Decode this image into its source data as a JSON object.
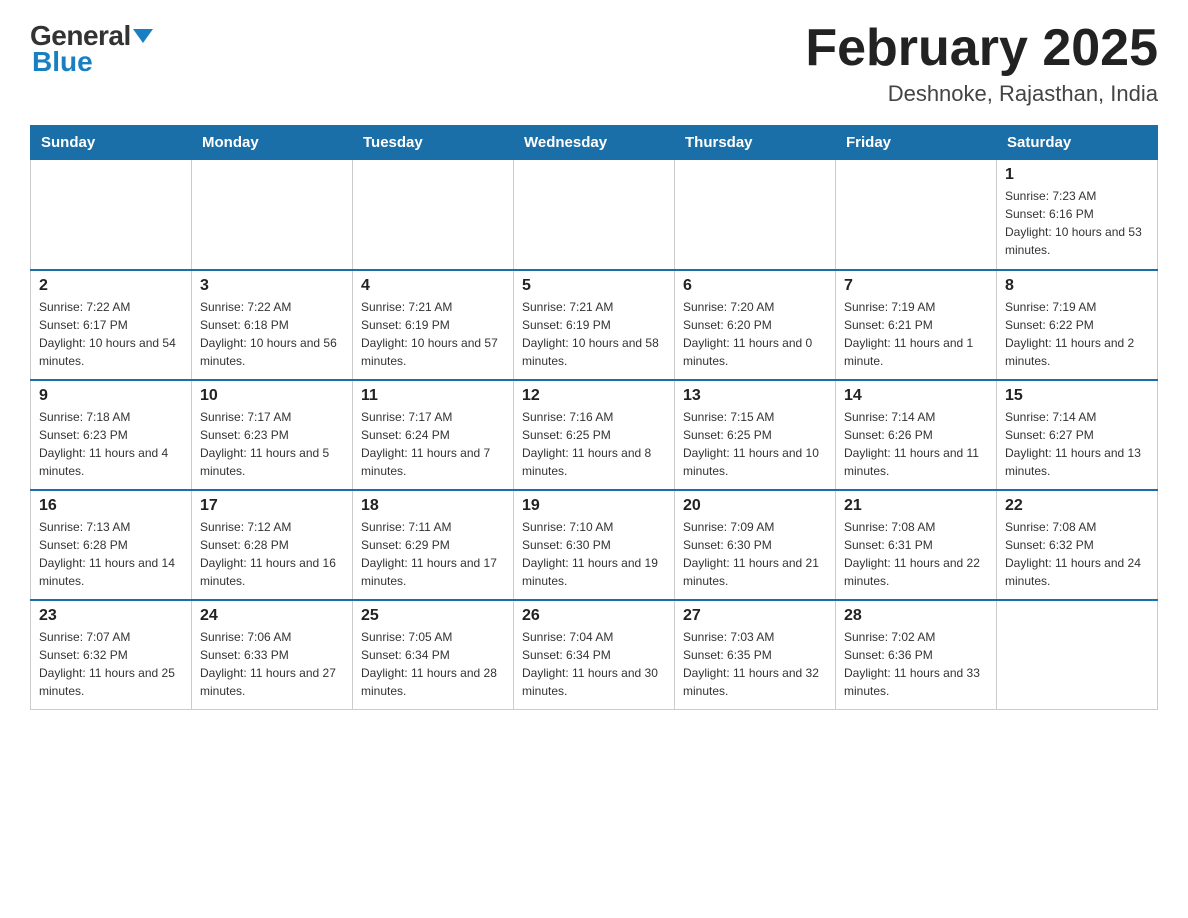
{
  "header": {
    "logo_general": "General",
    "logo_blue": "Blue",
    "title": "February 2025",
    "subtitle": "Deshnoke, Rajasthan, India"
  },
  "days_of_week": [
    "Sunday",
    "Monday",
    "Tuesday",
    "Wednesday",
    "Thursday",
    "Friday",
    "Saturday"
  ],
  "weeks": [
    [
      {
        "day": "",
        "sunrise": "",
        "sunset": "",
        "daylight": ""
      },
      {
        "day": "",
        "sunrise": "",
        "sunset": "",
        "daylight": ""
      },
      {
        "day": "",
        "sunrise": "",
        "sunset": "",
        "daylight": ""
      },
      {
        "day": "",
        "sunrise": "",
        "sunset": "",
        "daylight": ""
      },
      {
        "day": "",
        "sunrise": "",
        "sunset": "",
        "daylight": ""
      },
      {
        "day": "",
        "sunrise": "",
        "sunset": "",
        "daylight": ""
      },
      {
        "day": "1",
        "sunrise": "Sunrise: 7:23 AM",
        "sunset": "Sunset: 6:16 PM",
        "daylight": "Daylight: 10 hours and 53 minutes."
      }
    ],
    [
      {
        "day": "2",
        "sunrise": "Sunrise: 7:22 AM",
        "sunset": "Sunset: 6:17 PM",
        "daylight": "Daylight: 10 hours and 54 minutes."
      },
      {
        "day": "3",
        "sunrise": "Sunrise: 7:22 AM",
        "sunset": "Sunset: 6:18 PM",
        "daylight": "Daylight: 10 hours and 56 minutes."
      },
      {
        "day": "4",
        "sunrise": "Sunrise: 7:21 AM",
        "sunset": "Sunset: 6:19 PM",
        "daylight": "Daylight: 10 hours and 57 minutes."
      },
      {
        "day": "5",
        "sunrise": "Sunrise: 7:21 AM",
        "sunset": "Sunset: 6:19 PM",
        "daylight": "Daylight: 10 hours and 58 minutes."
      },
      {
        "day": "6",
        "sunrise": "Sunrise: 7:20 AM",
        "sunset": "Sunset: 6:20 PM",
        "daylight": "Daylight: 11 hours and 0 minutes."
      },
      {
        "day": "7",
        "sunrise": "Sunrise: 7:19 AM",
        "sunset": "Sunset: 6:21 PM",
        "daylight": "Daylight: 11 hours and 1 minute."
      },
      {
        "day": "8",
        "sunrise": "Sunrise: 7:19 AM",
        "sunset": "Sunset: 6:22 PM",
        "daylight": "Daylight: 11 hours and 2 minutes."
      }
    ],
    [
      {
        "day": "9",
        "sunrise": "Sunrise: 7:18 AM",
        "sunset": "Sunset: 6:23 PM",
        "daylight": "Daylight: 11 hours and 4 minutes."
      },
      {
        "day": "10",
        "sunrise": "Sunrise: 7:17 AM",
        "sunset": "Sunset: 6:23 PM",
        "daylight": "Daylight: 11 hours and 5 minutes."
      },
      {
        "day": "11",
        "sunrise": "Sunrise: 7:17 AM",
        "sunset": "Sunset: 6:24 PM",
        "daylight": "Daylight: 11 hours and 7 minutes."
      },
      {
        "day": "12",
        "sunrise": "Sunrise: 7:16 AM",
        "sunset": "Sunset: 6:25 PM",
        "daylight": "Daylight: 11 hours and 8 minutes."
      },
      {
        "day": "13",
        "sunrise": "Sunrise: 7:15 AM",
        "sunset": "Sunset: 6:25 PM",
        "daylight": "Daylight: 11 hours and 10 minutes."
      },
      {
        "day": "14",
        "sunrise": "Sunrise: 7:14 AM",
        "sunset": "Sunset: 6:26 PM",
        "daylight": "Daylight: 11 hours and 11 minutes."
      },
      {
        "day": "15",
        "sunrise": "Sunrise: 7:14 AM",
        "sunset": "Sunset: 6:27 PM",
        "daylight": "Daylight: 11 hours and 13 minutes."
      }
    ],
    [
      {
        "day": "16",
        "sunrise": "Sunrise: 7:13 AM",
        "sunset": "Sunset: 6:28 PM",
        "daylight": "Daylight: 11 hours and 14 minutes."
      },
      {
        "day": "17",
        "sunrise": "Sunrise: 7:12 AM",
        "sunset": "Sunset: 6:28 PM",
        "daylight": "Daylight: 11 hours and 16 minutes."
      },
      {
        "day": "18",
        "sunrise": "Sunrise: 7:11 AM",
        "sunset": "Sunset: 6:29 PM",
        "daylight": "Daylight: 11 hours and 17 minutes."
      },
      {
        "day": "19",
        "sunrise": "Sunrise: 7:10 AM",
        "sunset": "Sunset: 6:30 PM",
        "daylight": "Daylight: 11 hours and 19 minutes."
      },
      {
        "day": "20",
        "sunrise": "Sunrise: 7:09 AM",
        "sunset": "Sunset: 6:30 PM",
        "daylight": "Daylight: 11 hours and 21 minutes."
      },
      {
        "day": "21",
        "sunrise": "Sunrise: 7:08 AM",
        "sunset": "Sunset: 6:31 PM",
        "daylight": "Daylight: 11 hours and 22 minutes."
      },
      {
        "day": "22",
        "sunrise": "Sunrise: 7:08 AM",
        "sunset": "Sunset: 6:32 PM",
        "daylight": "Daylight: 11 hours and 24 minutes."
      }
    ],
    [
      {
        "day": "23",
        "sunrise": "Sunrise: 7:07 AM",
        "sunset": "Sunset: 6:32 PM",
        "daylight": "Daylight: 11 hours and 25 minutes."
      },
      {
        "day": "24",
        "sunrise": "Sunrise: 7:06 AM",
        "sunset": "Sunset: 6:33 PM",
        "daylight": "Daylight: 11 hours and 27 minutes."
      },
      {
        "day": "25",
        "sunrise": "Sunrise: 7:05 AM",
        "sunset": "Sunset: 6:34 PM",
        "daylight": "Daylight: 11 hours and 28 minutes."
      },
      {
        "day": "26",
        "sunrise": "Sunrise: 7:04 AM",
        "sunset": "Sunset: 6:34 PM",
        "daylight": "Daylight: 11 hours and 30 minutes."
      },
      {
        "day": "27",
        "sunrise": "Sunrise: 7:03 AM",
        "sunset": "Sunset: 6:35 PM",
        "daylight": "Daylight: 11 hours and 32 minutes."
      },
      {
        "day": "28",
        "sunrise": "Sunrise: 7:02 AM",
        "sunset": "Sunset: 6:36 PM",
        "daylight": "Daylight: 11 hours and 33 minutes."
      },
      {
        "day": "",
        "sunrise": "",
        "sunset": "",
        "daylight": ""
      }
    ]
  ]
}
